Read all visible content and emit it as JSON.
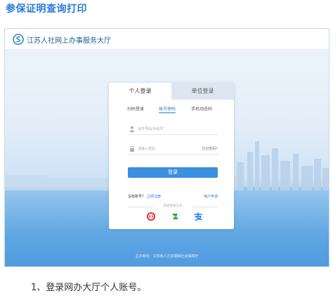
{
  "article_title": "参保证明查询打印",
  "site": {
    "title": "江苏人社网上办事服务大厅"
  },
  "login": {
    "tabs": [
      "个人登录",
      "单位登录"
    ],
    "subtabs": [
      "扫码登录",
      "账号密码",
      "手机动态码"
    ],
    "account_placeholder": "证件号码/手机号",
    "password_placeholder": "请输入密码",
    "forgot_label": "忘记密码?",
    "login_button": "登录",
    "no_account_label": "没有账号?",
    "register_label": "立即注册",
    "user_apply_label": "用户申请",
    "other_login_label": "其他登录方式",
    "apps": [
      "jiangsu-zhengwu-icon",
      "sushi-ban-icon",
      "alipay-icon"
    ]
  },
  "footer": "主办单位：江苏省人力资源和社会保障厅",
  "step": "1、登录网办大厅个人账号。",
  "colors": {
    "accent": "#2b7bd8",
    "button": "#3d8fe0"
  }
}
